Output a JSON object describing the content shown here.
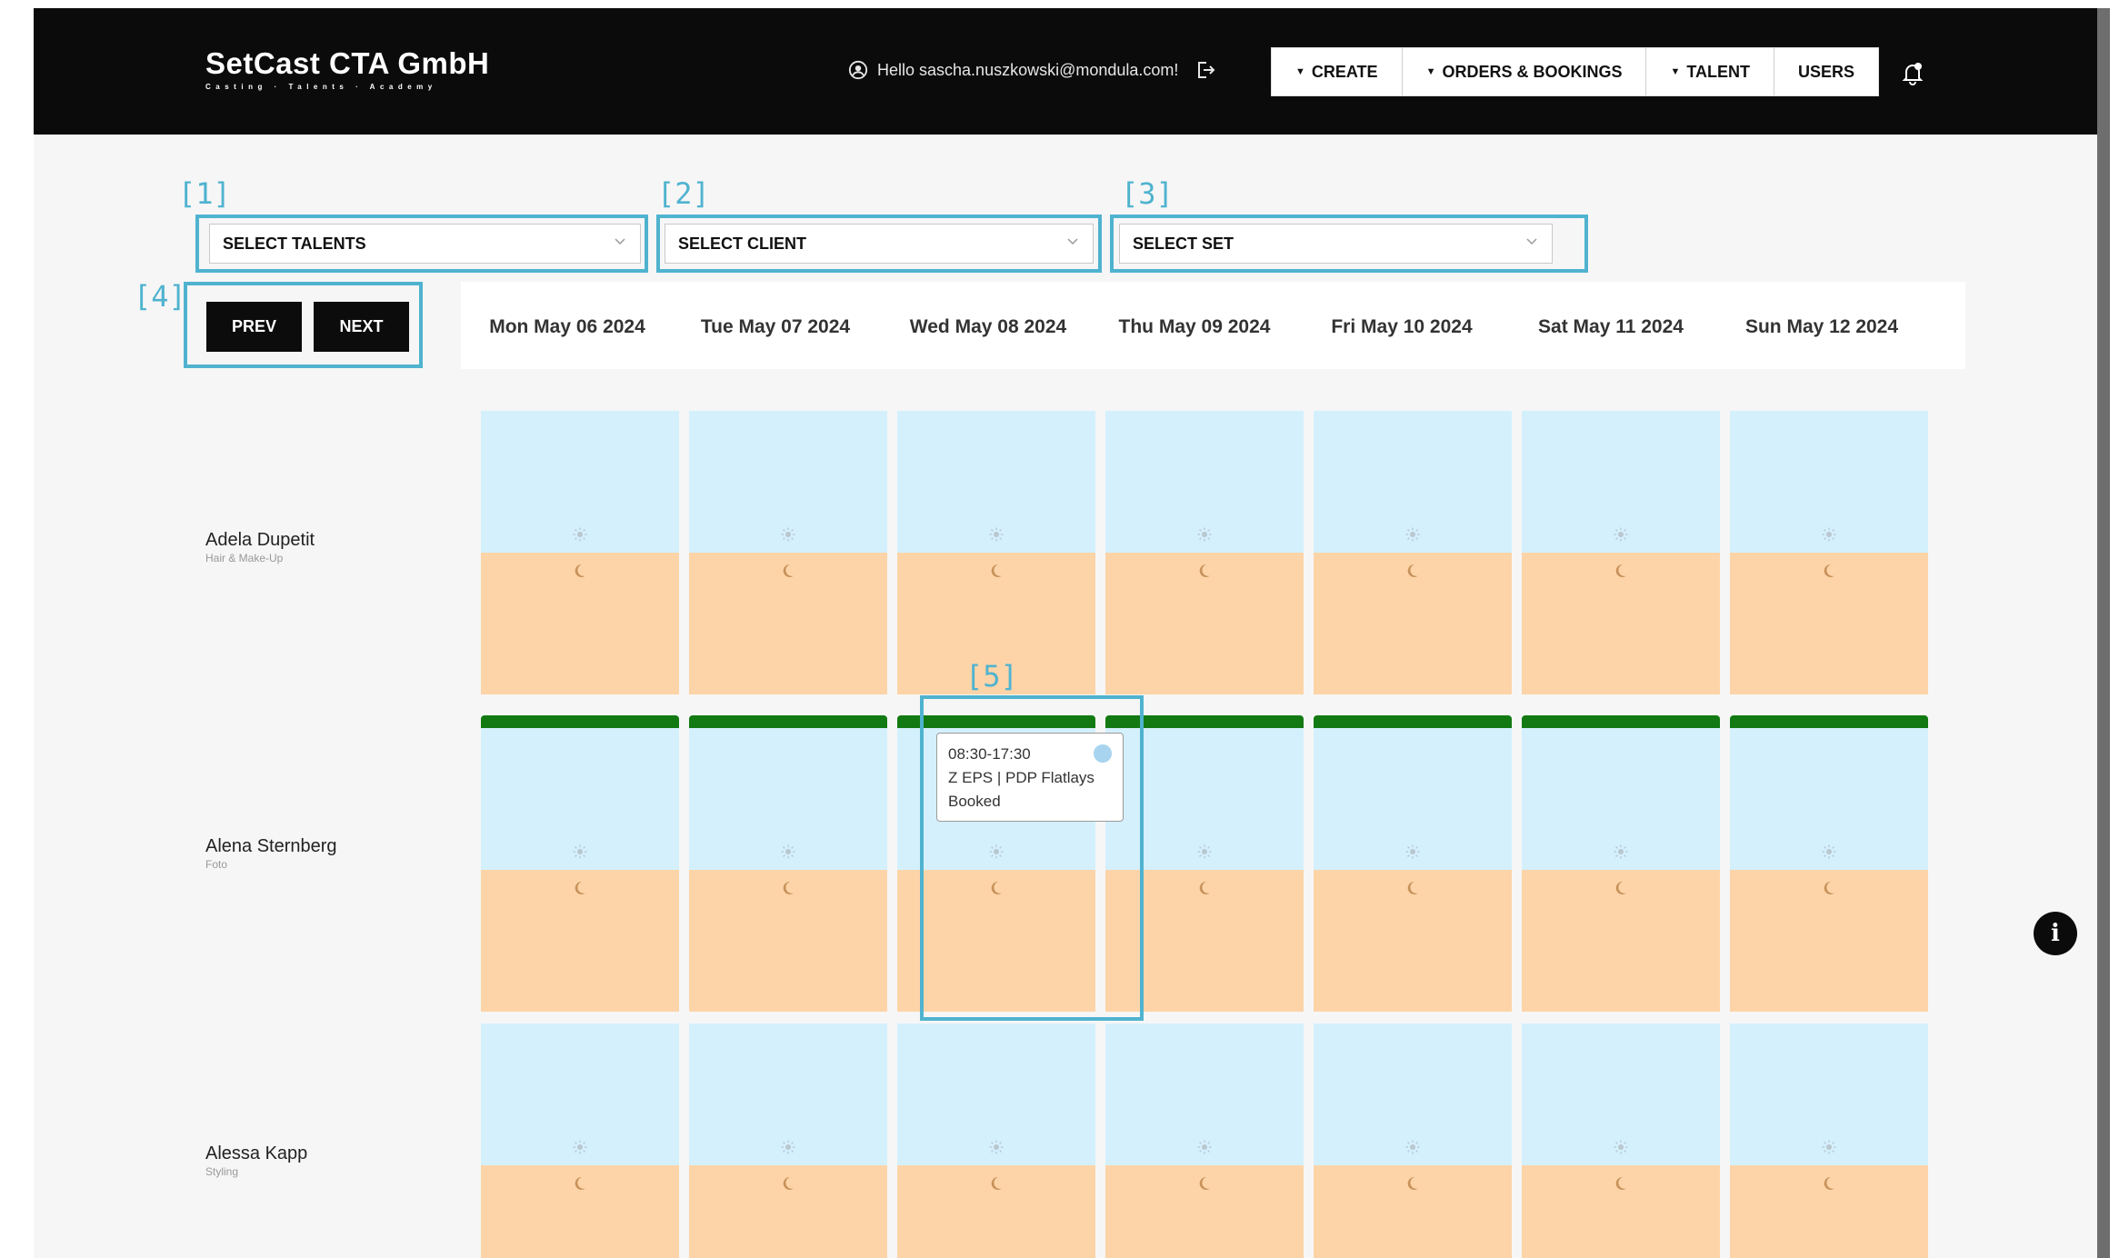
{
  "header": {
    "brand_title": "SetCast CTA GmbH",
    "brand_subtitle": "Casting · Talents · Academy",
    "greeting": "Hello sascha.nuszkowski@mondula.com!",
    "nav": [
      {
        "label": "CREATE",
        "caret": "▼"
      },
      {
        "label": "ORDERS & BOOKINGS",
        "caret": "▼"
      },
      {
        "label": "TALENT",
        "caret": "▼"
      },
      {
        "label": "USERS",
        "caret": ""
      }
    ]
  },
  "annotations": [
    "[1]",
    "[2]",
    "[3]",
    "[4]",
    "[5]"
  ],
  "filters": {
    "talents": "SELECT TALENTS",
    "client": "SELECT CLIENT",
    "set": "SELECT SET"
  },
  "pager": {
    "prev": "PREV",
    "next": "NEXT"
  },
  "days": [
    "Mon May 06 2024",
    "Tue May 07 2024",
    "Wed May 08 2024",
    "Thu May 09 2024",
    "Fri May 10 2024",
    "Sat May 11 2024",
    "Sun May 12 2024"
  ],
  "talents": [
    {
      "name": "Adela Dupetit",
      "role": "Hair & Make-Up"
    },
    {
      "name": "Alena Sternberg",
      "role": "Foto"
    },
    {
      "name": "Alessa Kapp",
      "role": "Styling"
    }
  ],
  "booking": {
    "time": "08:30-17:30",
    "title": "Z EPS | PDP Flatlays",
    "status": "Booked"
  },
  "colors": {
    "day_slot": "#d4f0fd",
    "night_slot": "#fdd4a8",
    "booked_bar": "#137a13",
    "annotation": "#4fb3cf"
  }
}
